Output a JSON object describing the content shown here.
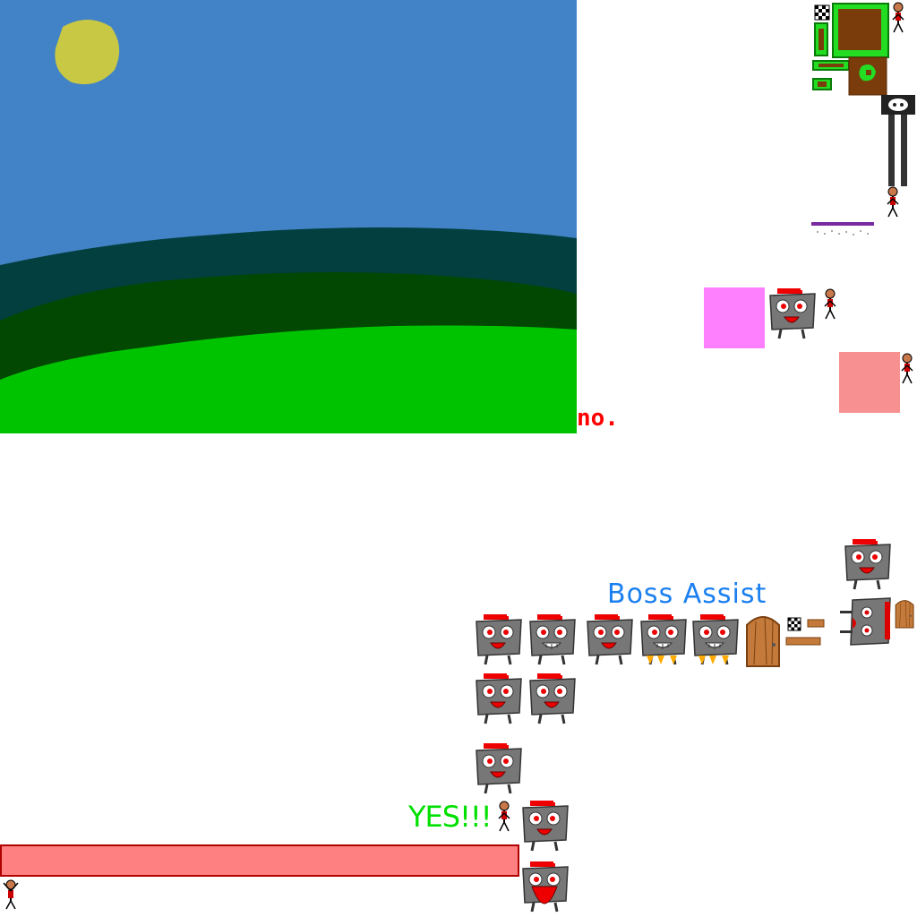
{
  "sprite_sheet": {
    "labels": {
      "no": "no.",
      "boss_assist": "Boss Assist",
      "yes": "YES!!!"
    },
    "health_bar": {
      "fill_fraction": 1.0
    },
    "colors": {
      "sky": "#4282c6",
      "sun": "#c8c844",
      "far_hills": "#033f3f",
      "mid_hills": "#024702",
      "grass": "#00c300",
      "no_text": "#ff0000",
      "boss_assist_text": "#1a7ff0",
      "yes_text": "#00e000",
      "pink_block": "#ff80ff",
      "salmon_block": "#f79191",
      "health_bar": "#ff8080",
      "health_border": "#b00000",
      "robot_body": "#777777",
      "robot_hat": "#ff0000",
      "door": "#c47a3a"
    },
    "icons": [
      "stick-figure-icon",
      "robot-sprite-icon",
      "door-icon",
      "checkered-flag-icon",
      "skull-pillar-icon",
      "wood-plank-icon",
      "grass-tile-icon",
      "dirt-tile-icon"
    ]
  }
}
